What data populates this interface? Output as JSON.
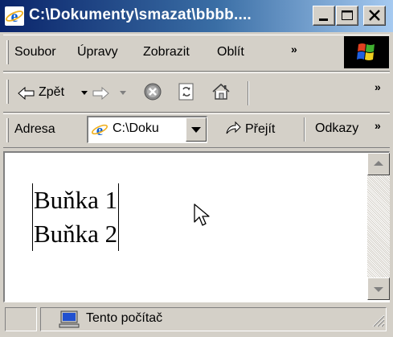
{
  "window": {
    "title": "C:\\Dokumenty\\smazat\\bbbb....",
    "controls": [
      "minimize-icon",
      "maximize-icon",
      "close-icon"
    ]
  },
  "menu": {
    "items": [
      "Soubor",
      "Úpravy",
      "Zobrazit",
      "Oblít"
    ],
    "overflow": "»"
  },
  "toolbar": {
    "back_label": "Zpět",
    "overflow": "»"
  },
  "address": {
    "label": "Adresa",
    "value": "C:\\Doku",
    "go_label": "Přejít",
    "links_label": "Odkazy",
    "overflow": "»"
  },
  "content": {
    "cells": [
      "Buňka 1",
      "Buňka 2"
    ]
  },
  "status": {
    "zone_label": "Tento počítač"
  },
  "colors": {
    "titlebar_start": "#0a246a",
    "titlebar_end": "#a6caf0",
    "face": "#d4d0c8",
    "content_bg": "#ffffff"
  }
}
